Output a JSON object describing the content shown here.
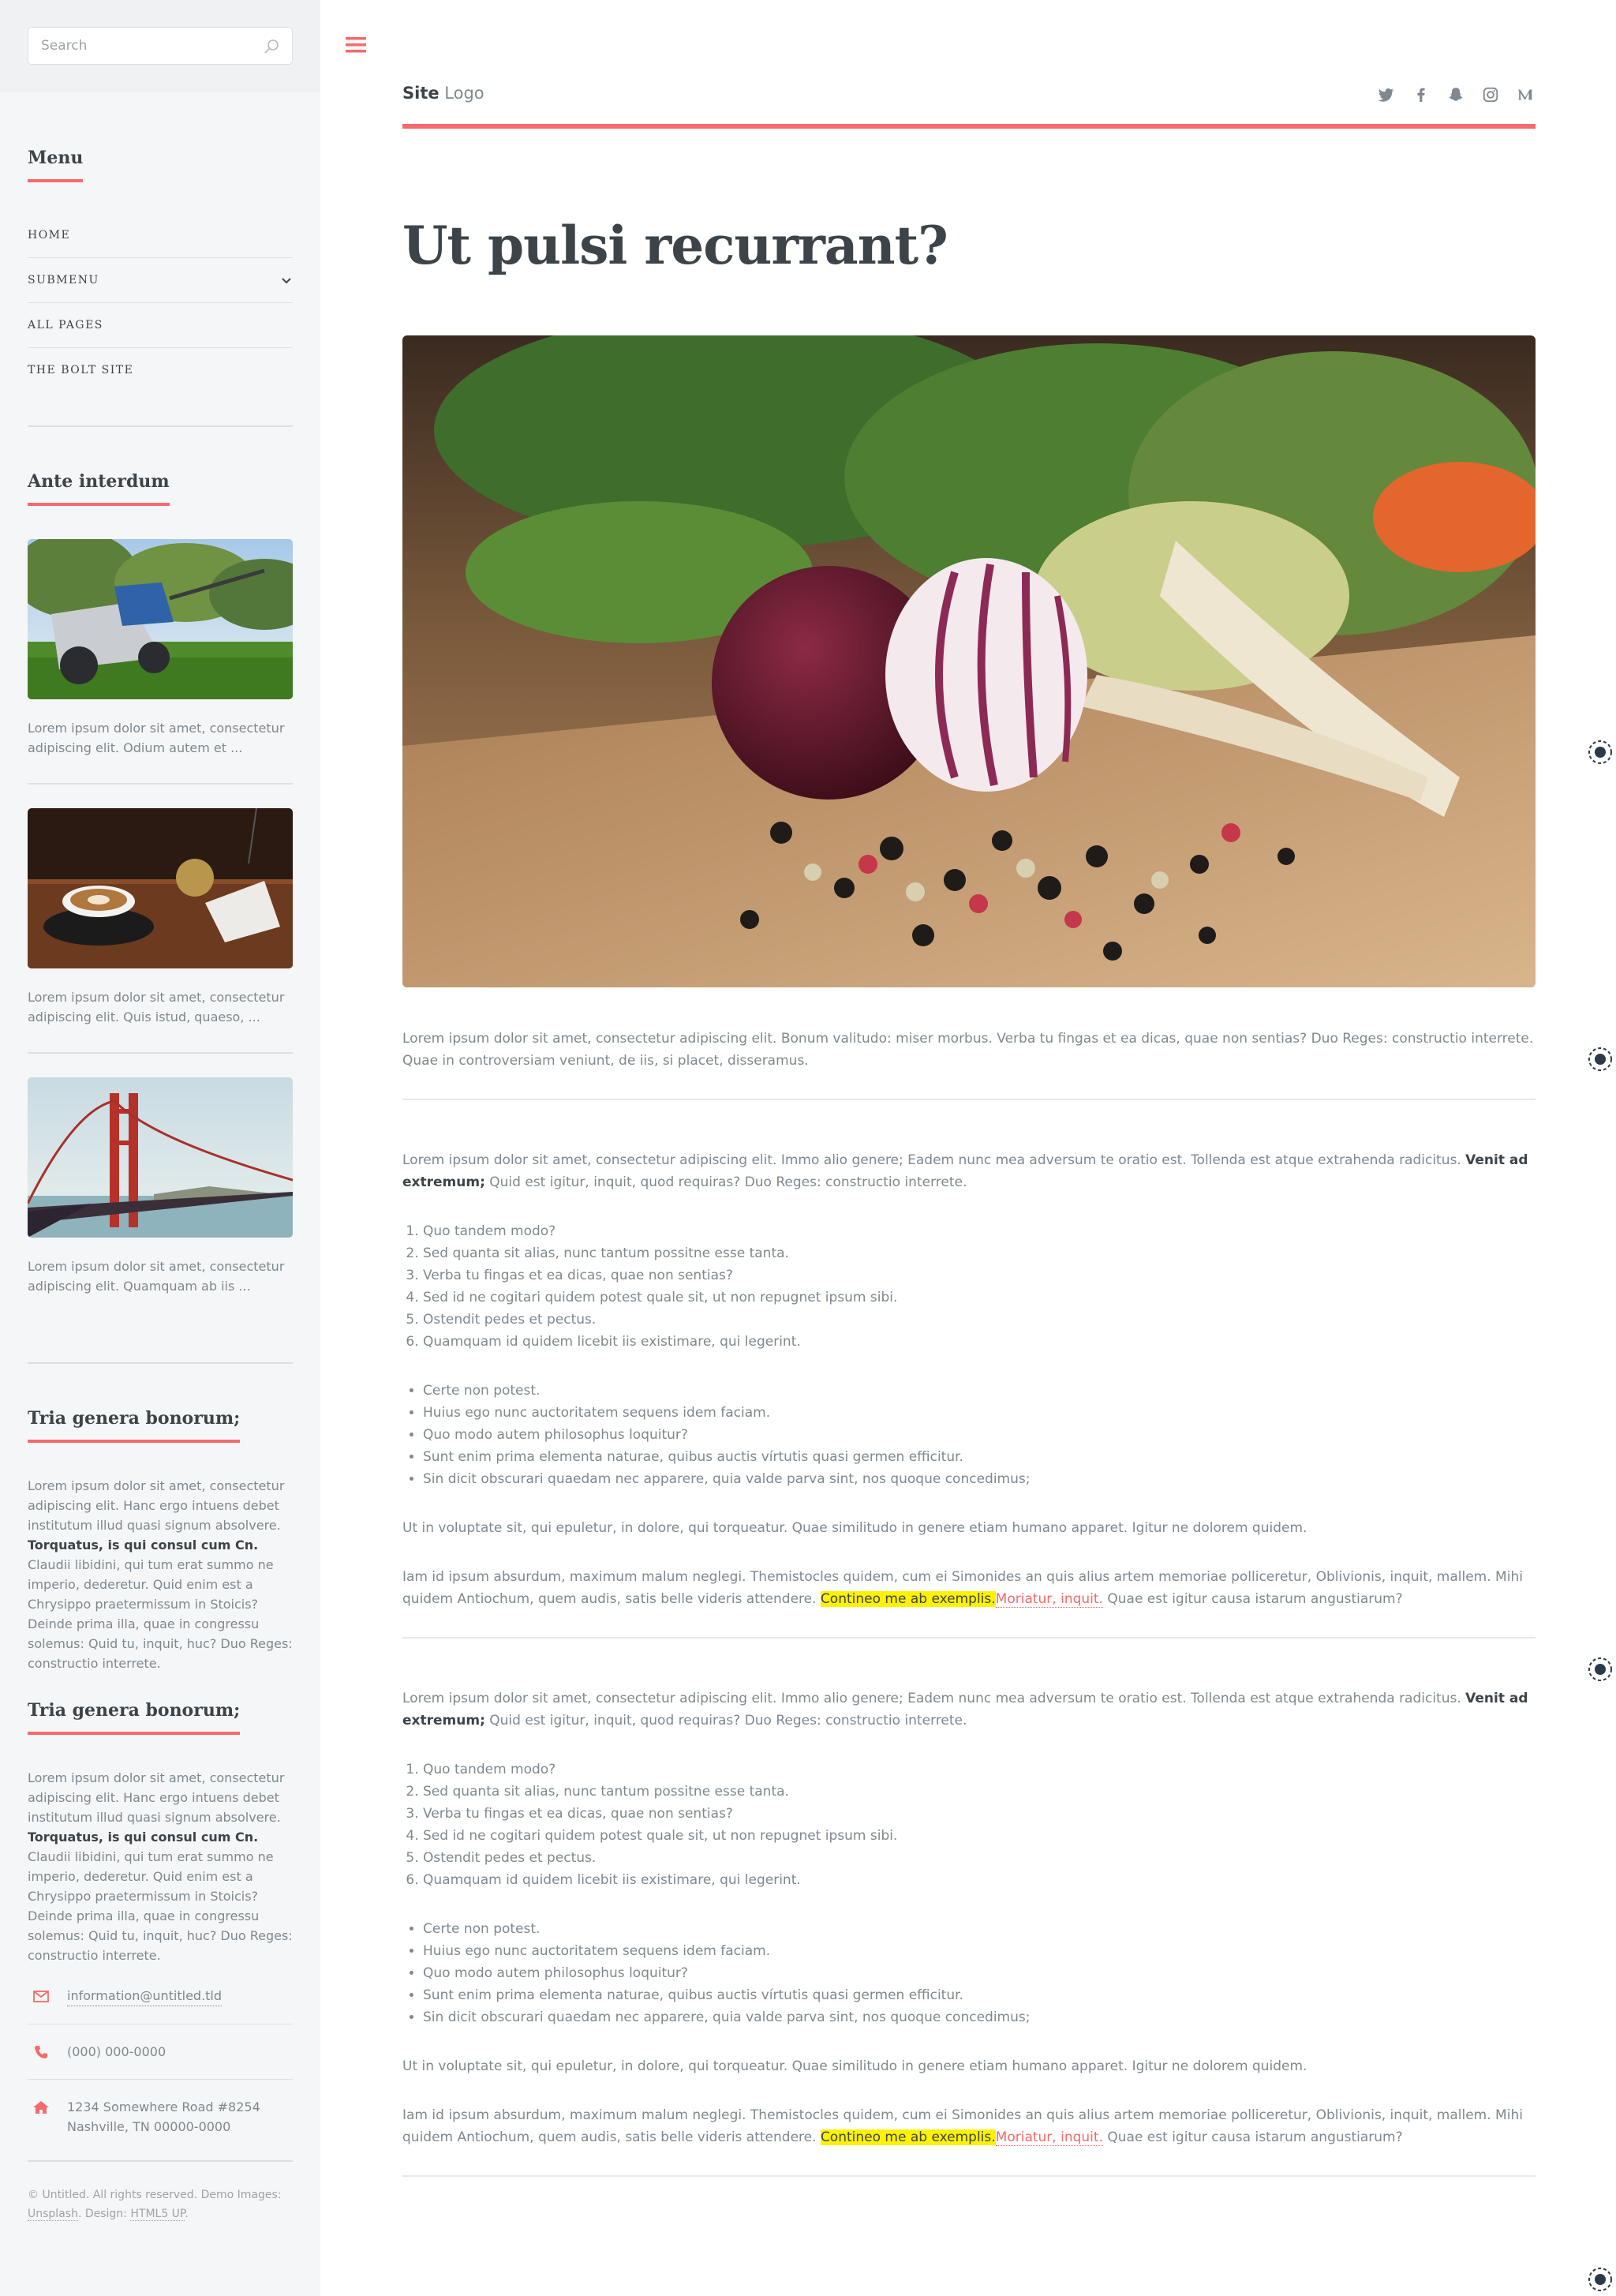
{
  "colors": {
    "accent": "#f56a6a",
    "text": "#7f888f",
    "heading": "#3d4449",
    "sidebar_bg": "#f5f6f7",
    "highlight": "#fff200"
  },
  "search": {
    "placeholder": "Search"
  },
  "menu": {
    "title": "Menu",
    "items": [
      {
        "label": "HOME",
        "has_submenu": false
      },
      {
        "label": "SUBMENU",
        "has_submenu": true
      },
      {
        "label": "ALL PAGES",
        "has_submenu": false
      },
      {
        "label": "THE BOLT SITE",
        "has_submenu": false
      }
    ]
  },
  "featured": {
    "title": "Ante interdum",
    "posts": [
      {
        "image": "lawn-mower",
        "text": "Lorem ipsum dolor sit amet, consectetur adipiscing elit. Odium autem et ..."
      },
      {
        "image": "coffee-cup",
        "text": "Lorem ipsum dolor sit amet, consectetur adipiscing elit. Quis istud, quaeso, ..."
      },
      {
        "image": "golden-gate-bridge",
        "text": "Lorem ipsum dolor sit amet, consectetur adipiscing elit. Quamquam ab iis ..."
      }
    ]
  },
  "blocks": [
    {
      "title": "Tria genera bonorum;",
      "text_a": "Lorem ipsum dolor sit amet, consectetur adipiscing elit. Hanc ergo intuens debet institutum illud quasi signum absolvere.",
      "text_bold": "Torquatus, is qui consul cum Cn.",
      "text_b": "Claudii libidini, qui tum erat summo ne imperio, dederetur. Quid enim est a Chrysippo praetermissum in Stoicis? Deinde prima illa, quae in congressu solemus: Quid tu, inquit, huc? Duo Reges: constructio interrete."
    },
    {
      "title": "Tria genera bonorum;",
      "text_a": "Lorem ipsum dolor sit amet, consectetur adipiscing elit. Hanc ergo intuens debet institutum illud quasi signum absolvere.",
      "text_bold": "Torquatus, is qui consul cum Cn.",
      "text_b": "Claudii libidini, qui tum erat summo ne imperio, dederetur. Quid enim est a Chrysippo praetermissum in Stoicis? Deinde prima illa, quae in congressu solemus: Quid tu, inquit, huc? Duo Reges: constructio interrete."
    }
  ],
  "contact": {
    "email": "information@untitled.tld",
    "phone": "(000) 000-0000",
    "address_line1": "1234 Somewhere Road #8254",
    "address_line2": "Nashville, TN 00000-0000"
  },
  "footer": {
    "text_a": "© Untitled. All rights reserved. Demo Images:",
    "unsplash": "Unsplash",
    "design_label": ". Design:",
    "html5up": "HTML5 UP",
    "end": "."
  },
  "header": {
    "logo_bold": "Site",
    "logo_rest": "Logo",
    "social_icons": [
      "twitter-icon",
      "facebook-icon",
      "snapchat-icon",
      "instagram-icon",
      "medium-icon"
    ]
  },
  "article": {
    "title": "Ut pulsi recurrant?",
    "hero_image": "vegetables-onion-peppercorns",
    "intro": "Lorem ipsum dolor sit amet, consectetur adipiscing elit. Bonum valitudo: miser morbus. Verba tu fingas et ea dicas, quae non sentias? Duo Reges: constructio interrete. Quae in controversiam veniunt, de iis, si placet, disseramus.",
    "sections": [
      {
        "p1_a": "Lorem ipsum dolor sit amet, consectetur adipiscing elit. Immo alio genere; Eadem nunc mea adversum te oratio est. Tollenda est atque extrahenda radicitus.",
        "p1_bold": "Venit ad extremum;",
        "p1_b": "Quid est igitur, inquit, quod requiras? Duo Reges: constructio interrete.",
        "ol": [
          "Quo tandem modo?",
          "Sed quanta sit alias, nunc tantum possitne esse tanta.",
          "Verba tu fingas et ea dicas, quae non sentias?",
          "Sed id ne cogitari quidem potest quale sit, ut non repugnet ipsum sibi.",
          "Ostendit pedes et pectus.",
          "Quamquam id quidem licebit iis existimare, qui legerint."
        ],
        "ul": [
          "Certe non potest.",
          "Huius ego nunc auctoritatem sequens idem faciam.",
          "Quo modo autem philosophus loquitur?",
          "Sunt enim prima elementa naturae, quibus auctis vírtutis quasi germen efficitur.",
          "Sin dicit obscurari quaedam nec apparere, quia valde parva sint, nos quoque concedimus;"
        ],
        "p2": "Ut in voluptate sit, qui epuletur, in dolore, qui torqueatur. Quae similitudo in genere etiam humano apparet. Igitur ne dolorem quidem.",
        "p3_a": "Iam id ipsum absurdum, maximum malum neglegi. Themistocles quidem, cum ei Simonides an quis alius artem memoriae polliceretur, Oblivionis, inquit, mallem. Mihi quidem Antiochum, quem audis, satis belle videris attendere.",
        "p3_mark": "Contineo me ab exemplis.",
        "p3_link": "Moriatur, inquit.",
        "p3_b": "Quae est igitur causa istarum angustiarum?"
      },
      {
        "p1_a": "Lorem ipsum dolor sit amet, consectetur adipiscing elit. Immo alio genere; Eadem nunc mea adversum te oratio est. Tollenda est atque extrahenda radicitus.",
        "p1_bold": "Venit ad extremum;",
        "p1_b": "Quid est igitur, inquit, quod requiras? Duo Reges: constructio interrete.",
        "ol": [
          "Quo tandem modo?",
          "Sed quanta sit alias, nunc tantum possitne esse tanta.",
          "Verba tu fingas et ea dicas, quae non sentias?",
          "Sed id ne cogitari quidem potest quale sit, ut non repugnet ipsum sibi.",
          "Ostendit pedes et pectus.",
          "Quamquam id quidem licebit iis existimare, qui legerint."
        ],
        "ul": [
          "Certe non potest.",
          "Huius ego nunc auctoritatem sequens idem faciam.",
          "Quo modo autem philosophus loquitur?",
          "Sunt enim prima elementa naturae, quibus auctis vírtutis quasi germen efficitur.",
          "Sin dicit obscurari quaedam nec apparere, quia valde parva sint, nos quoque concedimus;"
        ],
        "p2": "Ut in voluptate sit, qui epuletur, in dolore, qui torqueatur. Quae similitudo in genere etiam humano apparet. Igitur ne dolorem quidem.",
        "p3_a": "Iam id ipsum absurdum, maximum malum neglegi. Themistocles quidem, cum ei Simonides an quis alius artem memoriae polliceretur, Oblivionis, inquit, mallem. Mihi quidem Antiochum, quem audis, satis belle videris attendere.",
        "p3_mark": "Contineo me ab exemplis.",
        "p3_link": "Moriatur, inquit.",
        "p3_b": "Quae est igitur causa istarum angustiarum?"
      }
    ]
  }
}
